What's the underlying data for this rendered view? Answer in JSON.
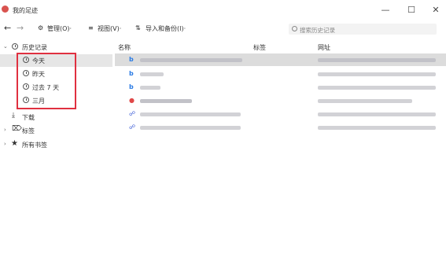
{
  "window": {
    "title": "我的足迹",
    "minimize": "—",
    "maximize": "☐",
    "close": "✕"
  },
  "toolbar": {
    "back": "←",
    "forward": "→",
    "manage": "管理(O)·",
    "view": "视图(V)·",
    "import_backup": "导入和备份(I)·",
    "search_placeholder": "搜索历史记录"
  },
  "sidebar": {
    "history": "历史记录",
    "today": "今天",
    "yesterday": "昨天",
    "past7": "过去 7 天",
    "march": "三月",
    "downloads": "下载",
    "tags": "标签",
    "all_bookmarks": "所有书签"
  },
  "columns": {
    "name": "名称",
    "tags": "标签",
    "url": "网址"
  },
  "rows": [
    {
      "icon": "bing-icon",
      "glyph": "b",
      "color": "#2a7be4"
    },
    {
      "icon": "bing-icon",
      "glyph": "b",
      "color": "#2a7be4"
    },
    {
      "icon": "bing-icon",
      "glyph": "b",
      "color": "#2a7be4"
    },
    {
      "icon": "red-site-icon",
      "glyph": "●",
      "color": "#e04848"
    },
    {
      "icon": "link-icon",
      "glyph": "☍",
      "color": "#3b5bd6"
    },
    {
      "icon": "link-icon",
      "glyph": "☍",
      "color": "#3b5bd6"
    }
  ]
}
